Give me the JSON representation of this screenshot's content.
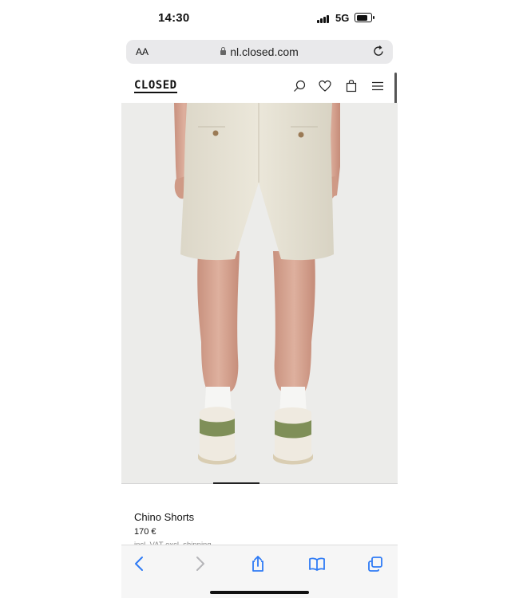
{
  "status_bar": {
    "time": "14:30",
    "network": "5G"
  },
  "browser": {
    "text_size_label": "AA",
    "url": "nl.closed.com",
    "icons": [
      "lock-icon",
      "reload-icon"
    ]
  },
  "site_header": {
    "logo": "CLOSED",
    "icons": [
      "search-icon",
      "heart-icon",
      "bag-icon",
      "menu-icon"
    ]
  },
  "product": {
    "title": "Chino Shorts",
    "price": "170 €",
    "vat_note": "incl. VAT excl. shipping"
  },
  "toolbar": {
    "icons": [
      "back-icon",
      "forward-icon",
      "share-icon",
      "bookmarks-icon",
      "tabs-icon"
    ]
  },
  "colors": {
    "shorts": "#e7e2d4",
    "skin": "#d9a895",
    "sneaker_accent": "#7f8f58",
    "image_background": "#ececea"
  }
}
